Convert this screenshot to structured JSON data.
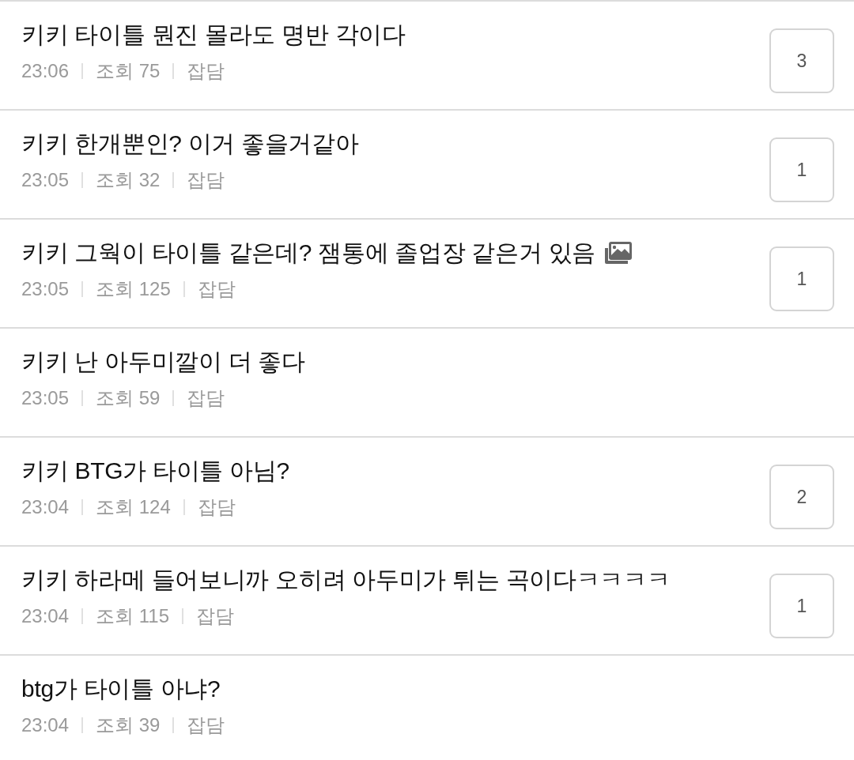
{
  "posts": [
    {
      "title": "키키 타이틀 뭔진 몰라도 명반 각이다",
      "has_image": false,
      "time": "23:06",
      "views": "조회 75",
      "category": "잡담",
      "comments": "3"
    },
    {
      "title": "키키 한개뿐인? 이거 좋을거같아",
      "has_image": false,
      "time": "23:05",
      "views": "조회 32",
      "category": "잡담",
      "comments": "1"
    },
    {
      "title": "키키 그웍이 타이틀 같은데? 잼통에 졸업장 같은거 있음",
      "has_image": true,
      "time": "23:05",
      "views": "조회 125",
      "category": "잡담",
      "comments": "1"
    },
    {
      "title": "키키 난 아두미깔이 더 좋다",
      "has_image": false,
      "time": "23:05",
      "views": "조회 59",
      "category": "잡담"
    },
    {
      "title": "키키 BTG가 타이틀 아님?",
      "has_image": false,
      "time": "23:04",
      "views": "조회 124",
      "category": "잡담",
      "comments": "2"
    },
    {
      "title": "키키 하라메 들어보니까 오히려 아두미가 튀는 곡이다ㅋㅋㅋㅋ",
      "has_image": false,
      "time": "23:04",
      "views": "조회 115",
      "category": "잡담",
      "comments": "1"
    },
    {
      "title": "btg가 타이틀 아냐?",
      "has_image": false,
      "time": "23:04",
      "views": "조회 39",
      "category": "잡담"
    }
  ]
}
